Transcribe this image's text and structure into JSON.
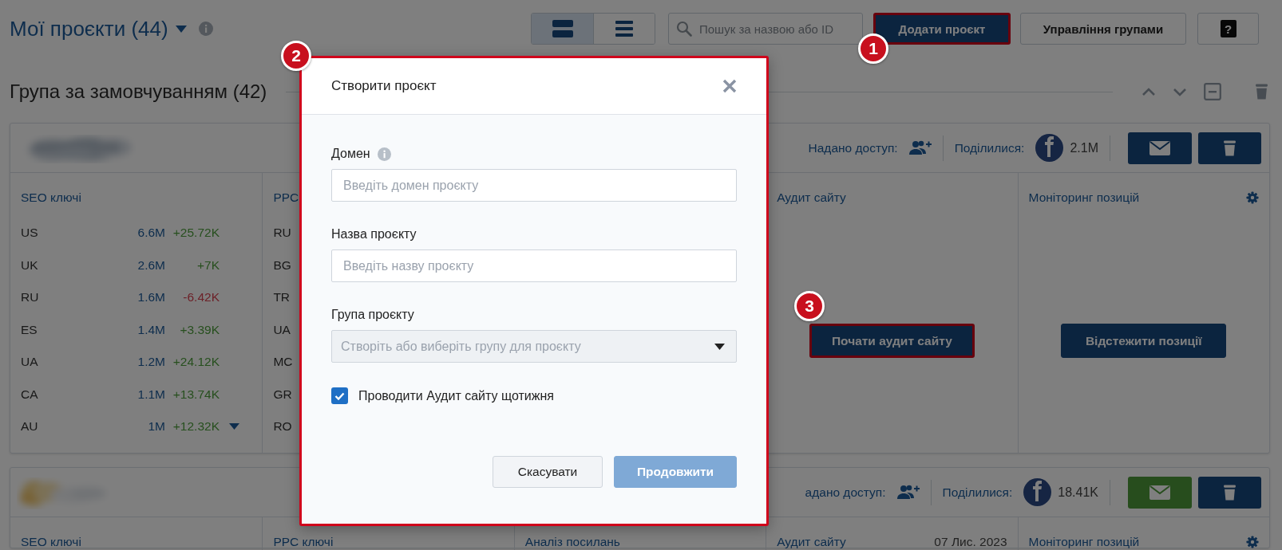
{
  "header": {
    "title": "Мої проєкти (44)",
    "view_modes": [
      {
        "kind": "cards",
        "selected": true
      },
      {
        "kind": "list",
        "selected": false
      }
    ],
    "search": {
      "placeholder": "Пошук за назвою або ID"
    },
    "buttons": [
      {
        "kind": "primary",
        "label": "Додати проєкт",
        "highlighted": true
      },
      {
        "kind": "secondary",
        "label": "Управління групами",
        "highlighted": false
      },
      {
        "kind": "help",
        "label": "?",
        "highlighted": false
      }
    ]
  },
  "group": {
    "title": "Група за замовчуванням (42)"
  },
  "cards": [
    {
      "access_label": "Надано доступ:",
      "shared_label": "Поділилися:",
      "shares": "2.1M",
      "mail_active": false,
      "columns": [
        {
          "kind": "metrics",
          "title": "SEO ключі",
          "expandable": true,
          "rows": [
            {
              "kind": "gain",
              "country": "US",
              "value": "6.6M",
              "change": "+25.72K"
            },
            {
              "kind": "gain",
              "country": "UK",
              "value": "2.6M",
              "change": "+7K"
            },
            {
              "kind": "loss",
              "country": "RU",
              "value": "1.6M",
              "change": "-6.42K"
            },
            {
              "kind": "gain",
              "country": "ES",
              "value": "1.4M",
              "change": "+3.39K"
            },
            {
              "kind": "gain",
              "country": "UA",
              "value": "1.2M",
              "change": "+24.12K"
            },
            {
              "kind": "gain",
              "country": "CA",
              "value": "1.1M",
              "change": "+13.74K"
            },
            {
              "kind": "gain",
              "country": "AU",
              "value": "1M",
              "change": "+12.32K"
            }
          ]
        },
        {
          "kind": "countries",
          "title": "PPC",
          "rows": [
            {
              "country": "RU"
            },
            {
              "country": "BG"
            },
            {
              "country": "TR"
            },
            {
              "country": "UA"
            },
            {
              "country": "MC"
            },
            {
              "country": "GR"
            },
            {
              "country": "RO"
            }
          ]
        },
        {
          "kind": "blank"
        },
        {
          "kind": "action",
          "title": "Аудит сайту",
          "settings": false,
          "action": {
            "label": "Почати аудит сайту",
            "highlighted": true
          }
        },
        {
          "kind": "action",
          "title": "Моніторинг позицій",
          "settings": true,
          "action": {
            "label": "Відстежити позиції",
            "highlighted": false
          }
        }
      ]
    },
    {
      "access_label": "адано доступ:",
      "shared_label": "Поділилися:",
      "shares": "18.41K",
      "mail_active": true,
      "columns": [
        {
          "kind": "header",
          "title": "SEO ключі",
          "settings": false
        },
        {
          "kind": "header",
          "title": "PPC ключі",
          "settings": false
        },
        {
          "kind": "header",
          "title": "Аналіз посилань",
          "settings": false
        },
        {
          "kind": "header",
          "title": "Аудит сайту",
          "date": "07 Лис. 2023",
          "settings": false
        },
        {
          "kind": "header",
          "title": "Моніторинг позицій",
          "settings": true
        }
      ]
    }
  ],
  "dialog": {
    "title": "Створити проєкт",
    "highlighted": true,
    "fields": [
      {
        "kind": "text",
        "label": "Домен",
        "info": true,
        "placeholder": "Введіть домен проєкту"
      },
      {
        "kind": "text",
        "label": "Назва проєкту",
        "info": false,
        "placeholder": "Введіть назву проєкту"
      },
      {
        "kind": "select",
        "label": "Група проєкту",
        "info": false,
        "placeholder": "Створіть або виберіть групу для проєкту"
      }
    ],
    "checkbox": {
      "label": "Проводити Аудит сайту щотижня",
      "checked": true
    },
    "buttons": [
      {
        "kind": "cancel",
        "label": "Скасувати",
        "disabled": false
      },
      {
        "kind": "submit",
        "label": "Продовжити",
        "disabled": true
      }
    ]
  },
  "markers": [
    {
      "label": "1"
    },
    {
      "label": "2"
    },
    {
      "label": "3"
    }
  ]
}
